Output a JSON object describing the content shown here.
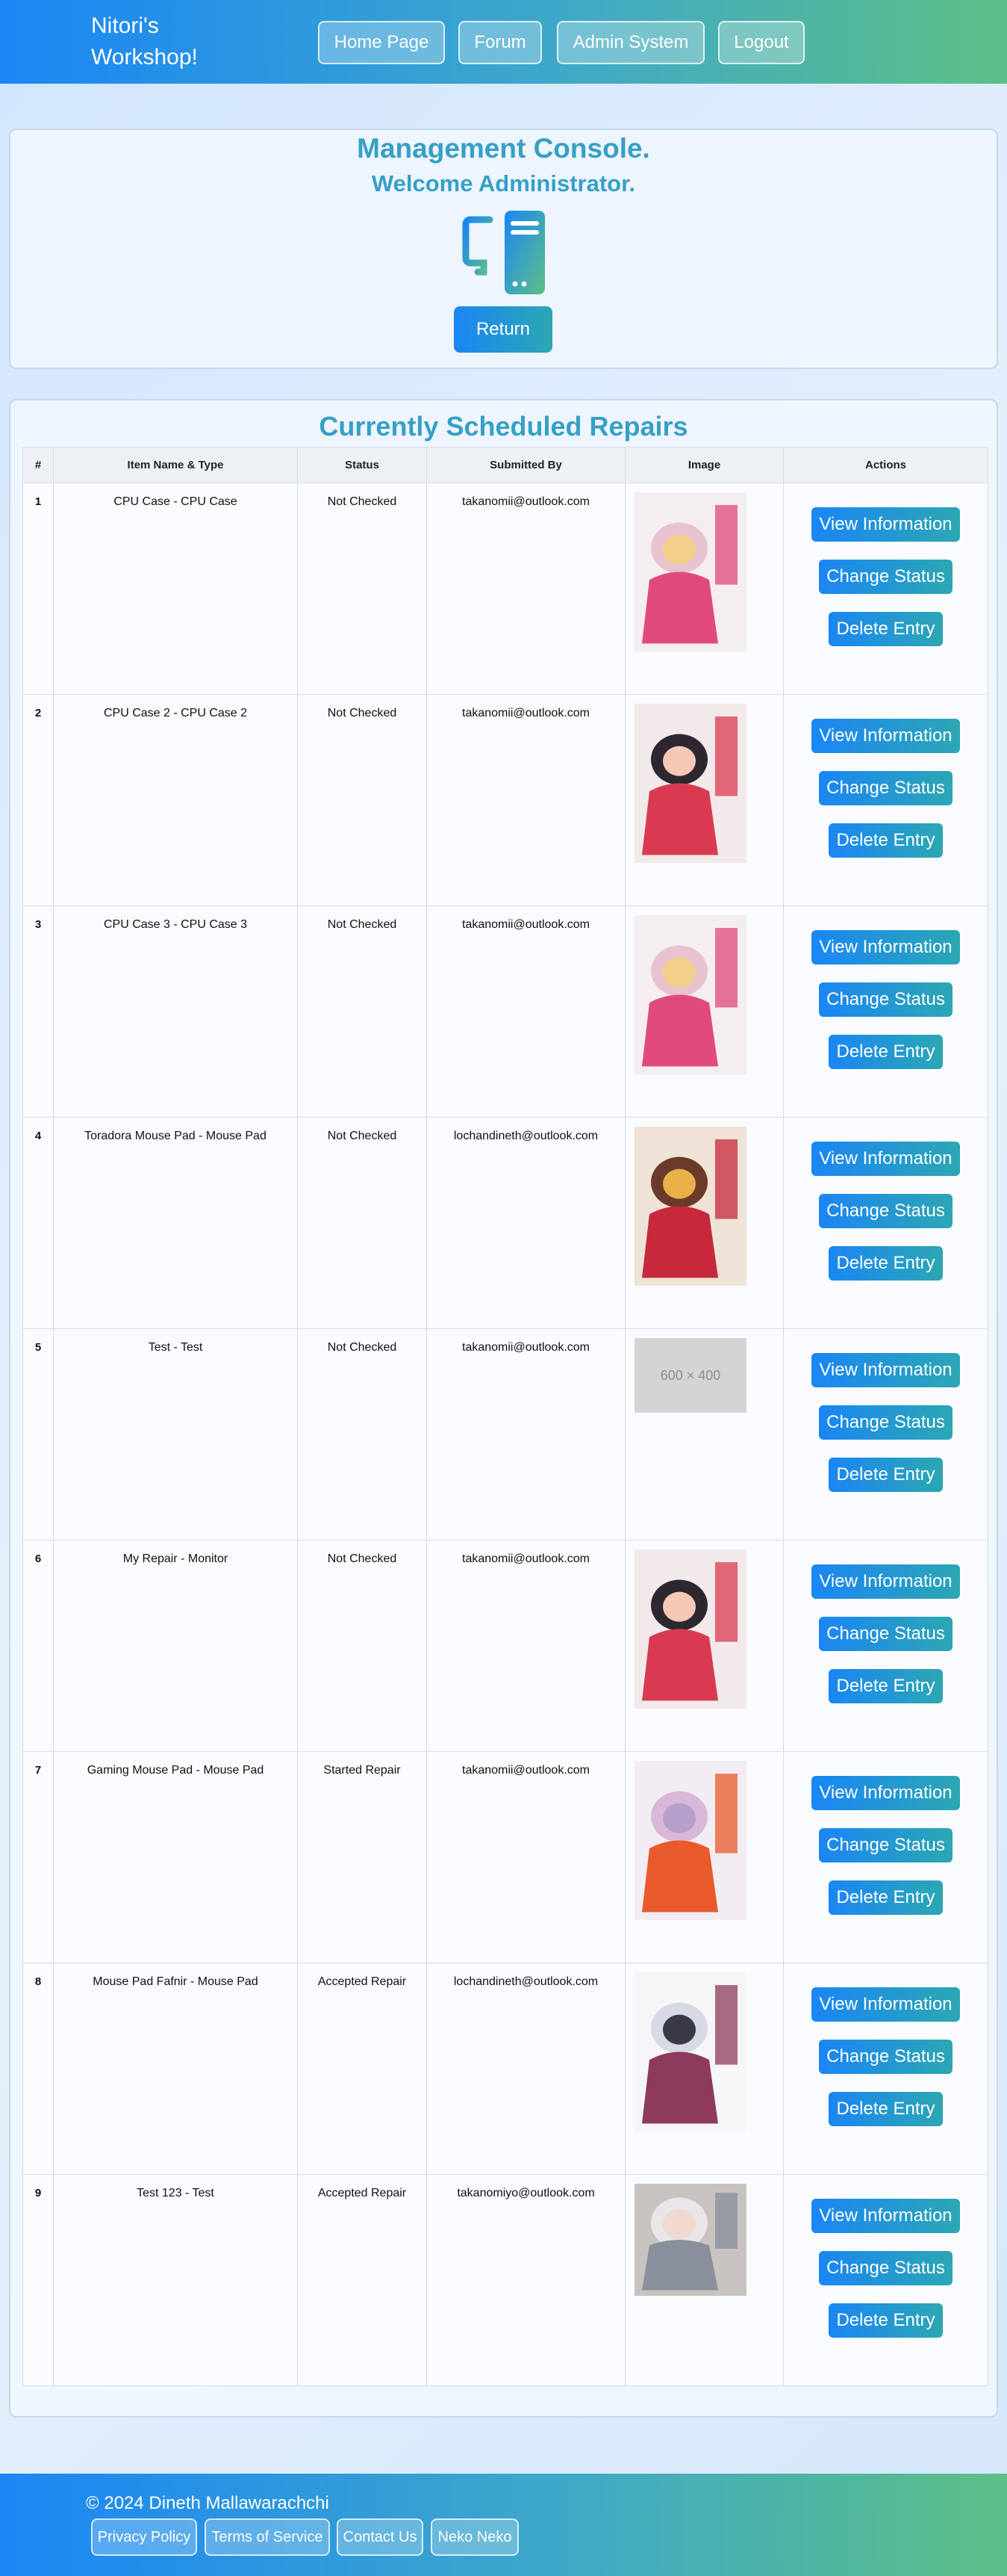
{
  "header": {
    "brand_line1": "Nitori's",
    "brand_line2": "Workshop!",
    "nav": [
      "Home Page",
      "Forum",
      "Admin System",
      "Logout"
    ]
  },
  "console": {
    "title": "Management Console.",
    "subtitle": "Welcome Administrator.",
    "icon": "computer-icon",
    "return_label": "Return"
  },
  "repairs": {
    "title": "Currently Scheduled Repairs",
    "columns": [
      "#",
      "Item Name & Type",
      "Status",
      "Submitted By",
      "Image",
      "Actions"
    ],
    "action_labels": {
      "view": "View Information",
      "change": "Change Status",
      "delete": "Delete Entry"
    },
    "rows": [
      {
        "num": "1",
        "item": "CPU Case - CPU Case",
        "status": "Not Checked",
        "by": "takanomii@outlook.com",
        "image": "cover-1"
      },
      {
        "num": "2",
        "item": "CPU Case 2 - CPU Case 2",
        "status": "Not Checked",
        "by": "takanomii@outlook.com",
        "image": "cover-2"
      },
      {
        "num": "3",
        "item": "CPU Case 3 - CPU Case 3",
        "status": "Not Checked",
        "by": "takanomii@outlook.com",
        "image": "cover-1"
      },
      {
        "num": "4",
        "item": "Toradora Mouse Pad - Mouse Pad",
        "status": "Not Checked",
        "by": "lochandineth@outlook.com",
        "image": "cover-3"
      },
      {
        "num": "5",
        "item": "Test - Test",
        "status": "Not Checked",
        "by": "takanomii@outlook.com",
        "image": "placeholder",
        "placeholder_text": "600 × 400"
      },
      {
        "num": "6",
        "item": "My Repair - Monitor",
        "status": "Not Checked",
        "by": "takanomii@outlook.com",
        "image": "cover-2"
      },
      {
        "num": "7",
        "item": "Gaming Mouse Pad - Mouse Pad",
        "status": "Started Repair",
        "by": "takanomii@outlook.com",
        "image": "cover-4"
      },
      {
        "num": "8",
        "item": "Mouse Pad Fafnir - Mouse Pad",
        "status": "Accepted Repair",
        "by": "lochandineth@outlook.com",
        "image": "cover-5"
      },
      {
        "num": "9",
        "item": "Test 123 - Test",
        "status": "Accepted Repair",
        "by": "takanomiyo@outlook.com",
        "image": "photo-6"
      }
    ]
  },
  "footer": {
    "copyright": "© 2024 Dineth Mallawarachchi",
    "links": [
      "Privacy Policy",
      "Terms of Service",
      "Contact Us",
      "Neko Neko"
    ]
  },
  "colors": {
    "accent": "#36a0c6",
    "gradient_start": "#1a86f5",
    "gradient_end": "#5cbf86"
  }
}
